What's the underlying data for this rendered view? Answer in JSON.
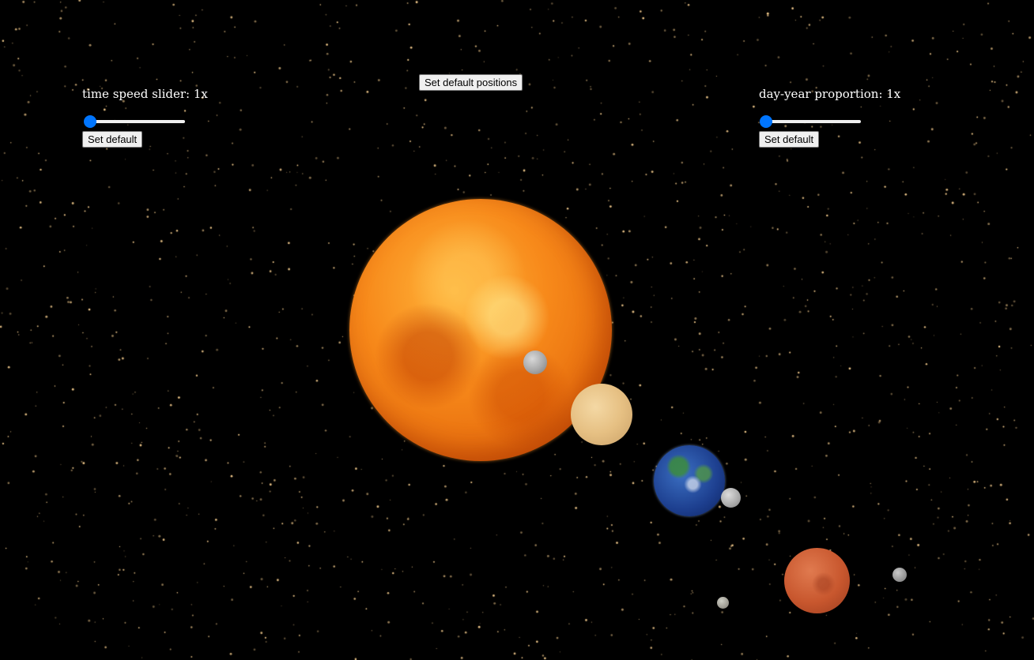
{
  "controls": {
    "time_speed": {
      "label": "time speed slider: 1x",
      "value_fraction": 0.0,
      "reset_label": "Set default"
    },
    "day_year": {
      "label": "day-year proportion: 1x",
      "value_fraction": 0.0,
      "reset_label": "Set default"
    },
    "reset_positions_label": "Set default positions"
  },
  "colors": {
    "slider_accent": "#0075ff",
    "background": "#000000",
    "star": "#f1c98b"
  },
  "bodies": [
    "sun",
    "mercury",
    "venus",
    "earth",
    "moon",
    "mars",
    "phobos",
    "deimos"
  ]
}
